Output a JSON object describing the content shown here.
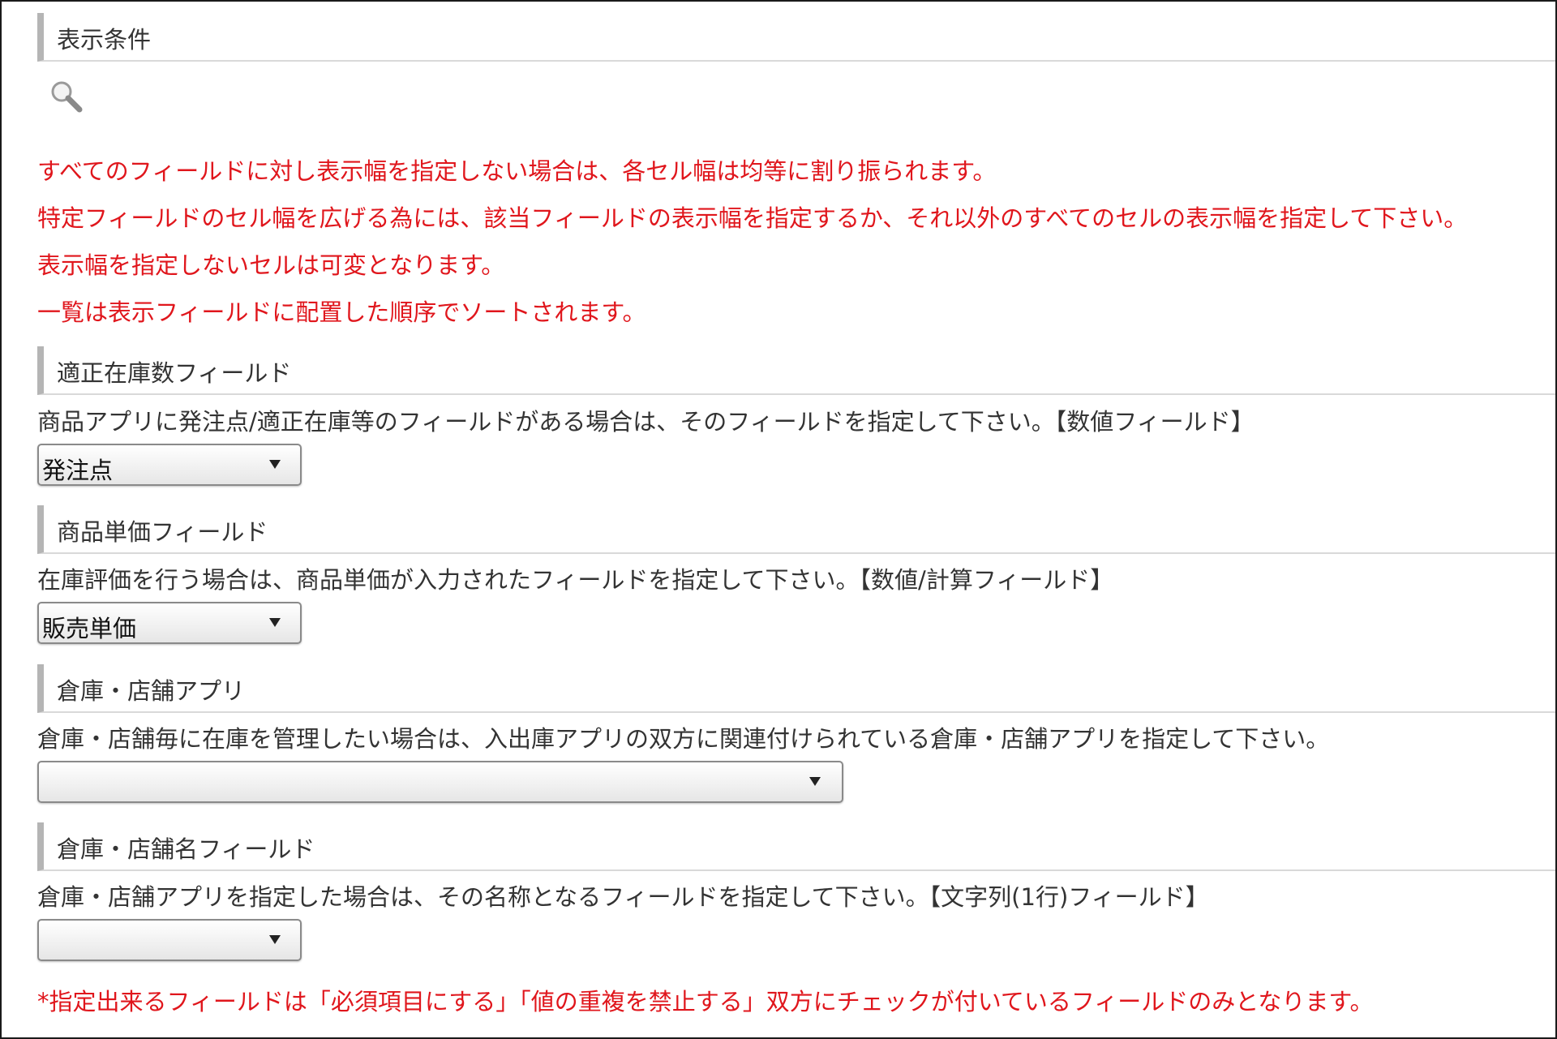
{
  "sections": {
    "display_conditions": {
      "title": "表示条件"
    },
    "stock_field": {
      "title": "適正在庫数フィールド",
      "description": "商品アプリに発注点/適正在庫等のフィールドがある場合は、そのフィールドを指定して下さい。【数値フィールド】",
      "selected": "発注点"
    },
    "price_field": {
      "title": "商品単価フィールド",
      "description": "在庫評価を行う場合は、商品単価が入力されたフィールドを指定して下さい。【数値/計算フィールド】",
      "selected": "販売単価"
    },
    "warehouse_app": {
      "title": "倉庫・店舗アプリ",
      "description": "倉庫・店舗毎に在庫を管理したい場合は、入出庫アプリの双方に関連付けられている倉庫・店舗アプリを指定して下さい。",
      "selected": ""
    },
    "warehouse_name_field": {
      "title": "倉庫・店舗名フィールド",
      "description": "倉庫・店舗アプリを指定した場合は、その名称となるフィールドを指定して下さい。【文字列(1行)フィールド】",
      "selected": ""
    }
  },
  "notes": {
    "line1": "すべてのフィールドに対し表示幅を指定しない場合は、各セル幅は均等に割り振られます。",
    "line2": "特定フィールドのセル幅を広げる為には、該当フィールドの表示幅を指定するか、それ以外のすべてのセルの表示幅を指定して下さい。",
    "line3": "表示幅を指定しないセルは可変となります。",
    "line4": "一覧は表示フィールドに配置した順序でソートされます。"
  },
  "footer_note": "*指定出来るフィールドは「必須項目にする」「値の重複を禁止する」双方にチェックが付いているフィールドのみとなります。",
  "colors": {
    "warning_text": "#e0161c",
    "header_bar": "#b5b5b5",
    "frame_border": "#1a1a1a"
  },
  "icons": {
    "search": "search-icon"
  }
}
